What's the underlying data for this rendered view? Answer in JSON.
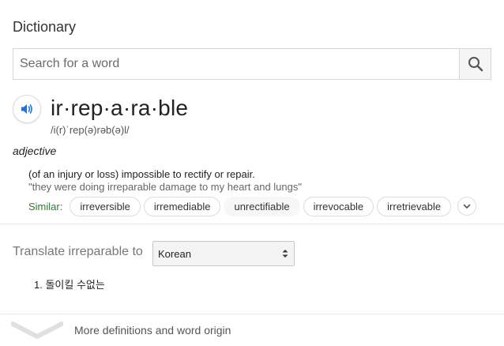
{
  "dictionary": {
    "title": "Dictionary",
    "search": {
      "placeholder": "Search for a word",
      "value": ""
    },
    "entry": {
      "headword": "ir·rep·a·ra·ble",
      "phonetic": "/i(r)ˈrep(ə)rəb(ə)l/",
      "part_of_speech": "adjective",
      "definition": "(of an injury or loss) impossible to rectify or repair.",
      "example": "\"they were doing irreparable damage to my heart and lungs\"",
      "similar_label": "Similar:",
      "similar": [
        "irreversible",
        "irremediable",
        "unrectifiable",
        "irrevocable",
        "irretrievable"
      ]
    },
    "translate": {
      "label": "Translate irreparable to",
      "language": "Korean",
      "results": [
        "1. 돌이킬 수없는"
      ]
    },
    "more_label": "More definitions and word origin"
  },
  "icons": {
    "search": "search-icon",
    "speaker": "speaker-icon",
    "expand": "chevron-down-icon",
    "select": "updown-arrows-icon",
    "more": "chevron-down-icon"
  },
  "colors": {
    "similar_label": "#2e7d32",
    "speaker": "#1a73e8",
    "divider": "#ebebeb"
  }
}
